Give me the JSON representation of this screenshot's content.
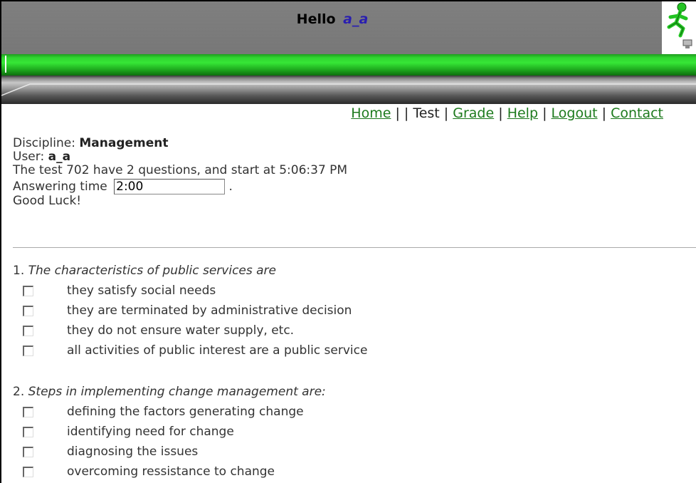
{
  "header": {
    "greeting": "Hello",
    "username": "a_a"
  },
  "nav": {
    "home": "Home",
    "test": "Test",
    "grade": "Grade",
    "help": "Help",
    "logout": "Logout",
    "contact": "Contact"
  },
  "info": {
    "discipline_label": "Discipline:",
    "discipline_value": "Management",
    "user_label": "User:",
    "user_value": "a_a",
    "test_line": "The test 702 have 2 questions, and start at 5:06:37 PM",
    "answer_time_label": "Answering time",
    "answer_time_value": "2:00",
    "good_luck": "Good Luck!"
  },
  "questions": [
    {
      "number": "1.",
      "text": "The characteristics of public services are",
      "answers": [
        "they satisfy social needs",
        "they are terminated by administrative decision",
        "they do not ensure water supply, etc.",
        "all activities of public interest are a public service"
      ]
    },
    {
      "number": "2.",
      "text": "Steps in implementing change management are:",
      "answers": [
        "defining the factors generating change",
        "identifying need for change",
        "diagnosing the issues",
        "overcoming ressistance to change"
      ]
    }
  ],
  "colors": {
    "link": "#1d7a1d",
    "username": "#2a1fb0",
    "green_bar": "#2fd52f",
    "banner": "#747474"
  },
  "icons": {
    "logo": "running-man-icon"
  }
}
